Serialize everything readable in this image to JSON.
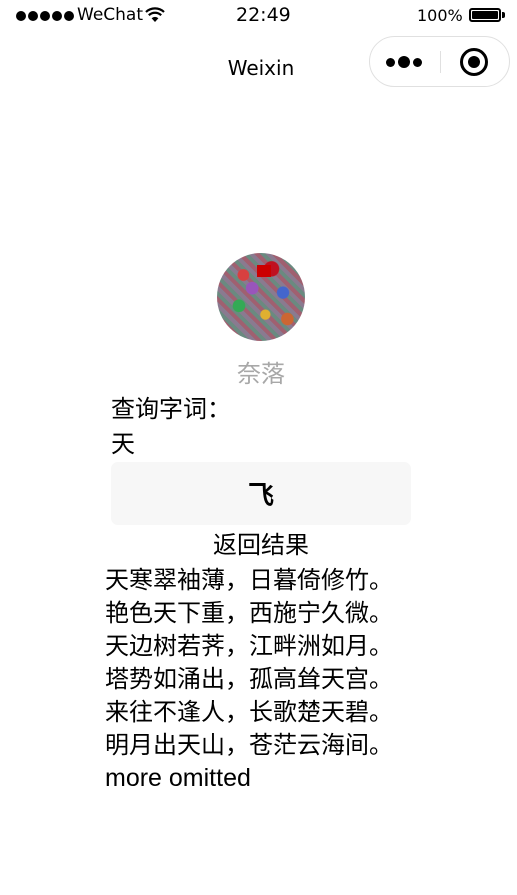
{
  "status_bar": {
    "carrier": "WeChat",
    "time": "22:49",
    "battery_percent": "100%",
    "battery_level": 1.0,
    "signal_icon": "signal-dots-icon",
    "wifi_icon": "wifi-icon",
    "battery_icon": "battery-icon"
  },
  "nav": {
    "title": "Weixin",
    "more_icon": "more-dots-icon",
    "close_icon": "target-circle-icon"
  },
  "profile": {
    "nickname": "奈落"
  },
  "query": {
    "label": "查询字词：",
    "value": "天"
  },
  "action": {
    "button_label": "飞"
  },
  "results": {
    "title": "返回结果",
    "lines": [
      "天寒翠袖薄，日暮倚修竹。",
      "艳色天下重，西施宁久微。",
      "天边树若荠，江畔洲如月。",
      "塔势如涌出，孤高耸天宫。",
      "来往不逢人，长歌楚天碧。",
      "明月出天山，苍茫云海间。"
    ],
    "more": "more omitted"
  },
  "colors": {
    "background": "#ffffff",
    "nickname": "#a8a8a8",
    "button_bg": "#f7f7f7",
    "capsule_border": "#e0e0e0"
  }
}
